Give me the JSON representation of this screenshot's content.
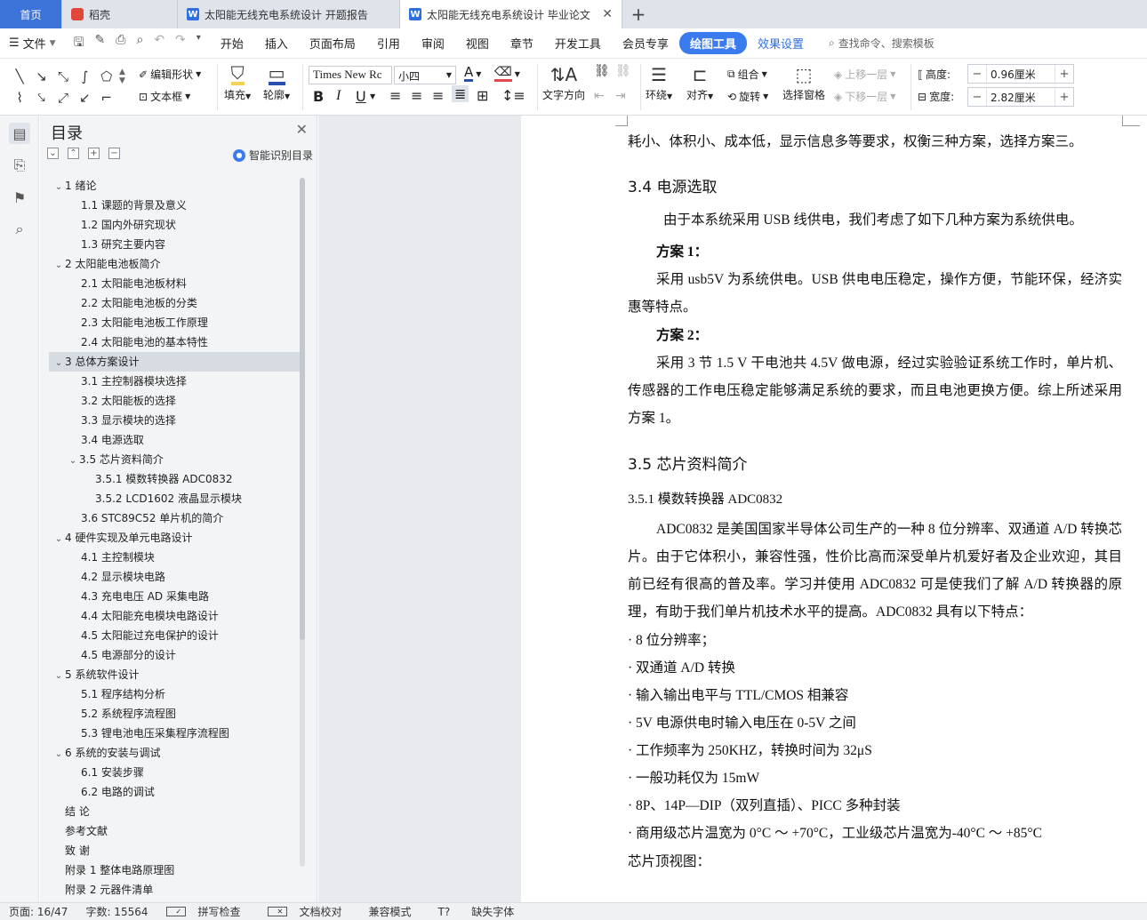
{
  "tabs": {
    "home": "首页",
    "tab1": "稻壳",
    "tab2": "太阳能无线充电系统设计 开题报告",
    "tab3": "太阳能无线充电系统设计 毕业论文"
  },
  "menu": {
    "file": "文件",
    "items": [
      "开始",
      "插入",
      "页面布局",
      "引用",
      "审阅",
      "视图",
      "章节",
      "开发工具",
      "会员专享"
    ],
    "active": "绘图工具",
    "effect": "效果设置",
    "search": "查找命令、搜索模板"
  },
  "ribbon": {
    "edit_shape": "编辑形状",
    "text_box": "文本框",
    "fill": "填充",
    "outline": "轮廓",
    "font_name": "Times New Rc",
    "font_size": "小四",
    "text_dir": "文字方向",
    "wrap": "环绕",
    "align": "对齐",
    "group": "组合",
    "rotate": "旋转",
    "selection_pane": "选择窗格",
    "bring_forward": "上移一层",
    "send_backward": "下移一层",
    "height_label": "高度:",
    "height_value": "0.96厘米",
    "width_label": "宽度:",
    "width_value": "2.82厘米"
  },
  "toc": {
    "title": "目录",
    "smart": "智能识别目录",
    "items": [
      {
        "level": 1,
        "caret": "v",
        "text": "1  绪论"
      },
      {
        "level": 2,
        "text": "1.1 课题的背景及意义"
      },
      {
        "level": 2,
        "text": "1.2 国内外研究现状"
      },
      {
        "level": 2,
        "text": "1.3 研究主要内容"
      },
      {
        "level": 1,
        "caret": "v",
        "text": "2  太阳能电池板简介"
      },
      {
        "level": 2,
        "text": "2.1 太阳能电池板材料"
      },
      {
        "level": 2,
        "text": "2.2 太阳能电池板的分类"
      },
      {
        "level": 2,
        "text": "2.3 太阳能电池板工作原理"
      },
      {
        "level": 2,
        "text": "2.4 太阳能电池的基本特性"
      },
      {
        "level": 1,
        "caret": "v",
        "text": "3  总体方案设计",
        "selected": true
      },
      {
        "level": 2,
        "text": "3.1 主控制器模块选择"
      },
      {
        "level": 2,
        "text": "3.2 太阳能板的选择"
      },
      {
        "level": 2,
        "text": "3.3 显示模块的选择"
      },
      {
        "level": 2,
        "text": "3.4 电源选取"
      },
      {
        "level": 2,
        "caret": "v",
        "text": "3.5 芯片资料简介"
      },
      {
        "level": 3,
        "text": "3.5.1 模数转换器 ADC0832"
      },
      {
        "level": 3,
        "text": "3.5.2 LCD1602 液晶显示模块"
      },
      {
        "level": 2,
        "text": "3.6 STC89C52 单片机的简介"
      },
      {
        "level": 1,
        "caret": "v",
        "text": "4  硬件实现及单元电路设计"
      },
      {
        "level": 2,
        "text": "4.1 主控制模块"
      },
      {
        "level": 2,
        "text": "4.2 显示模块电路"
      },
      {
        "level": 2,
        "text": "4.3 充电电压 AD 采集电路"
      },
      {
        "level": 2,
        "text": "4.4 太阳能充电模块电路设计"
      },
      {
        "level": 2,
        "text": "4.5 太阳能过充电保护的设计"
      },
      {
        "level": 2,
        "text": "4.5 电源部分的设计"
      },
      {
        "level": 1,
        "caret": "v",
        "text": "5  系统软件设计"
      },
      {
        "level": 2,
        "text": "5.1 程序结构分析"
      },
      {
        "level": 2,
        "text": "5.2 系统程序流程图"
      },
      {
        "level": 2,
        "text": "5.3 锂电池电压采集程序流程图"
      },
      {
        "level": 1,
        "caret": "v",
        "text": "6  系统的安装与调试"
      },
      {
        "level": 2,
        "text": "6.1 安装步骤"
      },
      {
        "level": 2,
        "text": "6.2 电路的调试"
      },
      {
        "level": 1,
        "text": "结    论"
      },
      {
        "level": 1,
        "text": "参考文献"
      },
      {
        "level": 1,
        "text": "致    谢"
      },
      {
        "level": 1,
        "text": "附录 1 整体电路原理图"
      },
      {
        "level": 1,
        "text": "附录 2 元器件清单"
      }
    ]
  },
  "doc": {
    "line0": "耗小、体积小、成本低，显示信息多等要求，权衡三种方案，选择方案三。",
    "h34": "3.4 电源选取",
    "p1": "由于本系统采用 USB 线供电，我们考虑了如下几种方案为系统供电。",
    "plan1": "方案 1：",
    "p2": "采用 usb5V 为系统供电。USB 供电电压稳定，操作方便，节能环保，经济实惠等特点。",
    "plan2": "方案 2：",
    "p3": "采用 3 节 1.5 V 干电池共 4.5V 做电源，经过实验验证系统工作时，单片机、传感器的工作电压稳定能够满足系统的要求，而且电池更换方便。综上所述采用方案 1。",
    "h35": "3.5 芯片资料简介",
    "h351": "3.5.1 模数转换器 ADC0832",
    "p4": "ADC0832 是美国国家半导体公司生产的一种 8 位分辨率、双通道 A/D 转换芯片。由于它体积小，兼容性强，性价比高而深受单片机爱好者及企业欢迎，其目前已经有很高的普及率。学习并使用 ADC0832 可是使我们了解 A/D 转换器的原理，有助于我们单片机技术水平的提高。ADC0832 具有以下特点：",
    "bullets": [
      "· 8 位分辨率；",
      "·  双通道 A/D 转换",
      "·  输入输出电平与 TTL/CMOS 相兼容",
      "· 5V 电源供电时输入电压在 0-5V 之间",
      "·  工作频率为 250KHZ，转换时间为 32μS",
      "·  一般功耗仅为 15mW",
      "· 8P、14P—DIP（双列直插）、PICC  多种封装",
      "·  商用级芯片温宽为 0°C  ～  +70°C，工业级芯片温宽为-40°C  ～  +85°C"
    ],
    "last": "芯片顶视图："
  },
  "status": {
    "page": "页面: 16/47",
    "words": "字数: 15564",
    "spell": "拼写检查",
    "proof": "文档校对",
    "compat": "兼容模式",
    "missing_font": "缺失字体"
  }
}
